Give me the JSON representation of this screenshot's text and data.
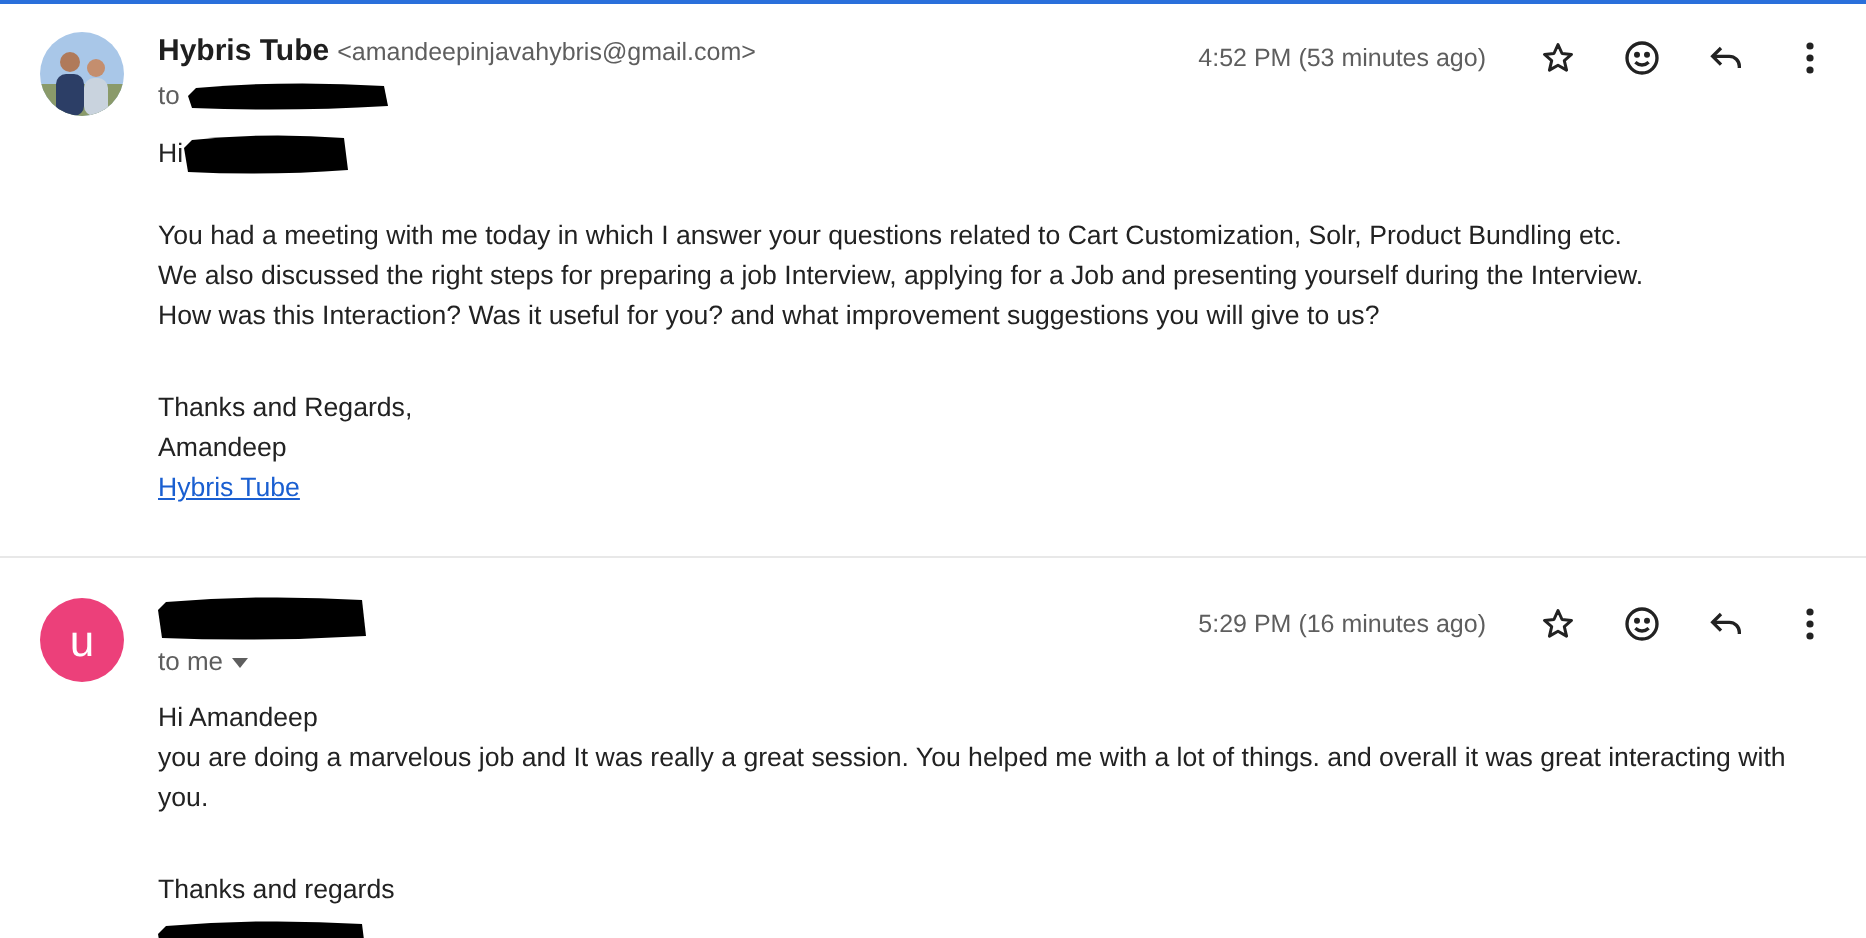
{
  "messages": [
    {
      "sender": {
        "kind": "picture",
        "name": "Hybris Tube",
        "email": "<amandeepinjavahybris@gmail.com>",
        "redacted": false
      },
      "recipient": {
        "prefix": "to",
        "redacted": true,
        "caret": false
      },
      "time": "4:52 PM (53 minutes ago)",
      "greeting": {
        "text": "Hi",
        "redacted": true
      },
      "body": [
        "You had a meeting with me today in which I answer your questions related to Cart Customization, Solr, Product Bundling etc.",
        "We also discussed the right steps for preparing a job Interview, applying for a Job and presenting yourself during the Interview.",
        "How was this Interaction? Was it useful for you? and what improvement suggestions you will give to us?"
      ],
      "signoff": [
        "Thanks and Regards,",
        "Amandeep"
      ],
      "link": "Hybris Tube",
      "signature_redacted": false
    },
    {
      "sender": {
        "kind": "letter",
        "letter": "u",
        "color": "#ec407a",
        "redacted": true
      },
      "recipient": {
        "prefix": "to me",
        "redacted": false,
        "caret": true
      },
      "time": "5:29 PM (16 minutes ago)",
      "greeting": {
        "text": "Hi Amandeep",
        "redacted": false
      },
      "body": [
        "you are doing a marvelous job and It was really a great session. You helped me with a lot of things. and overall it was great interacting with you."
      ],
      "signoff": [
        "Thanks and regards"
      ],
      "signature_redacted": true
    }
  ]
}
